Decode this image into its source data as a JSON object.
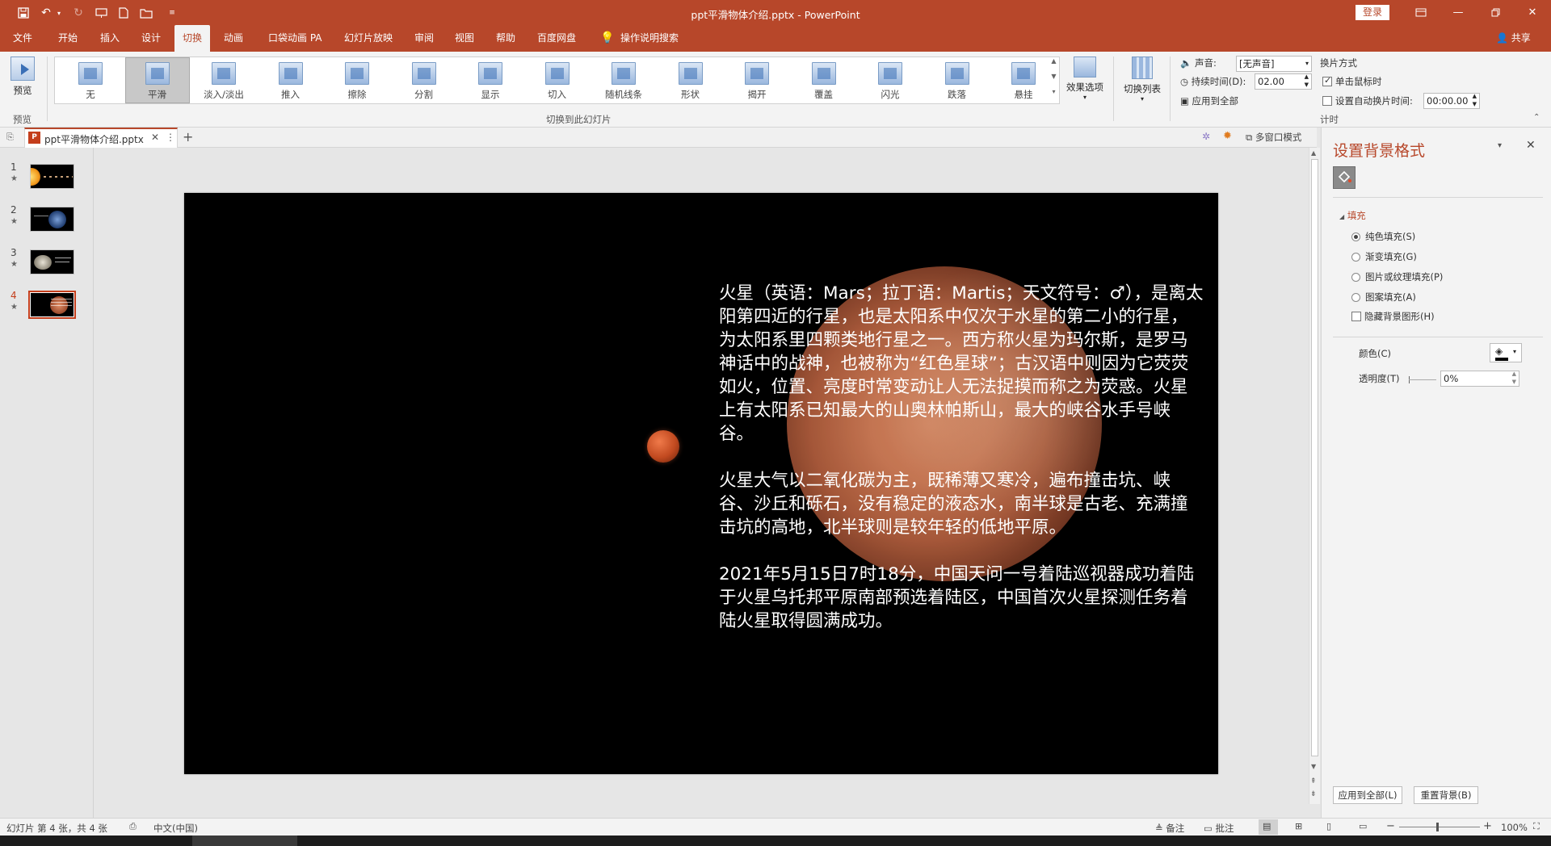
{
  "window": {
    "title": "ppt平滑物体介绍.pptx  -  PowerPoint",
    "login_label": "登录",
    "share_label": "共享"
  },
  "menu": {
    "items": [
      "文件",
      "开始",
      "插入",
      "设计",
      "切换",
      "动画",
      "口袋动画 PA",
      "幻灯片放映",
      "审阅",
      "视图",
      "帮助",
      "百度网盘"
    ],
    "active": "切换",
    "search_label": "操作说明搜索"
  },
  "ribbon": {
    "preview_label": "预览",
    "preview_group": "预览",
    "transitions": [
      "无",
      "平滑",
      "淡入/淡出",
      "推入",
      "擦除",
      "分割",
      "显示",
      "切入",
      "随机线条",
      "形状",
      "揭开",
      "覆盖",
      "闪光",
      "跌落",
      "悬挂"
    ],
    "selected_transition": "平滑",
    "effect_options": "效果选项",
    "group_label": "切换到此幻灯片",
    "switch_list": "切换列表",
    "sound_label": "声音:",
    "sound_value": "[无声音]",
    "duration_label": "持续时间(D):",
    "duration_value": "02.00",
    "apply_all": "应用到全部",
    "advance_title": "换片方式",
    "on_click": "单击鼠标时",
    "auto_advance": "设置自动换片时间:",
    "auto_time": "00:00.00",
    "timing_group": "计时"
  },
  "tab": {
    "filename": "ppt平滑物体介绍.pptx",
    "multiwindow": "多窗口模式"
  },
  "thumbnails": [
    {
      "num": "1",
      "star": "★"
    },
    {
      "num": "2",
      "star": "★"
    },
    {
      "num": "3",
      "star": "★"
    },
    {
      "num": "4",
      "star": "★"
    }
  ],
  "selected_slide": 4,
  "slide": {
    "paragraphs": [
      "火星（英语：Mars；拉丁语：Martis；天文符号：♂），是离太阳第四近的行星，也是太阳系中仅次于水星的第二小的行星，为太阳系里四颗类地行星之一。西方称火星为玛尔斯，是罗马神话中的战神，也被称为“红色星球”；古汉语中则因为它荧荧如火，位置、亮度时常变动让人无法捉摸而称之为荧惑。火星上有太阳系已知最大的山奥林帕斯山，最大的峡谷水手号峡谷。",
      "火星大气以二氧化碳为主，既稀薄又寒冷，遍布撞击坑、峡谷、沙丘和砾石，没有稳定的液态水，南半球是古老、充满撞击坑的高地，北半球则是较年轻的低地平原。",
      "2021年5月15日7时18分，中国天问一号着陆巡视器成功着陆于火星乌托邦平原南部预选着陆区，中国首次火星探测任务着陆火星取得圆满成功。"
    ]
  },
  "pane": {
    "title": "设置背景格式",
    "section": "填充",
    "options": [
      "纯色填充(S)",
      "渐变填充(G)",
      "图片或纹理填充(P)",
      "图案填充(A)"
    ],
    "selected_option": 0,
    "hide_bg": "隐藏背景图形(H)",
    "color_label": "颜色(C)",
    "transparency_label": "透明度(T)",
    "transparency_value": "0%",
    "apply_all": "应用到全部(L)",
    "reset": "重置背景(B)"
  },
  "status": {
    "slide_info": "幻灯片 第 4 张，共 4 张",
    "language": "中文(中国)",
    "notes": "备注",
    "comments": "批注",
    "zoom": "100%"
  }
}
